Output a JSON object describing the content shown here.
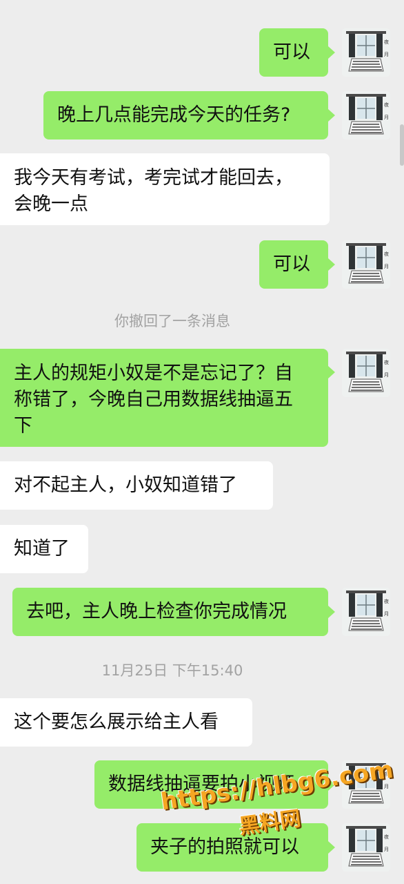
{
  "messages": [
    {
      "text": "可以"
    },
    {
      "text": "晚上几点能完成今天的任务?"
    },
    {
      "lines": [
        "我今天有考试，考完试才能回去，",
        "会晚一点"
      ]
    },
    {
      "text": "可以"
    },
    {
      "system": "你撤回了一条消息"
    },
    {
      "lines": [
        "主人的规矩小奴是不是忘记了？自",
        "称错了，今晚自己用数据线抽逼五",
        "下"
      ]
    },
    {
      "text": "对不起主人，小奴知道错了"
    },
    {
      "text": "知道了"
    },
    {
      "text": "去吧，主人晚上检查你完成情况"
    },
    {
      "timestamp": "11月25日 下午15:40"
    },
    {
      "text": "这个要怎么展示给主人看"
    },
    {
      "text": "数据线抽逼要拍小视频"
    },
    {
      "text": "夹子的拍照就可以"
    }
  ],
  "watermark": {
    "url": "https://hlbg6.com",
    "name": "黑料网"
  },
  "colors": {
    "background": "#ededed",
    "outgoing_bubble": "#95ec69",
    "incoming_bubble": "#ffffff",
    "system_text": "#a2a2a2",
    "watermark": "#f5a623"
  },
  "icons": [
    "avatar-window-image"
  ]
}
